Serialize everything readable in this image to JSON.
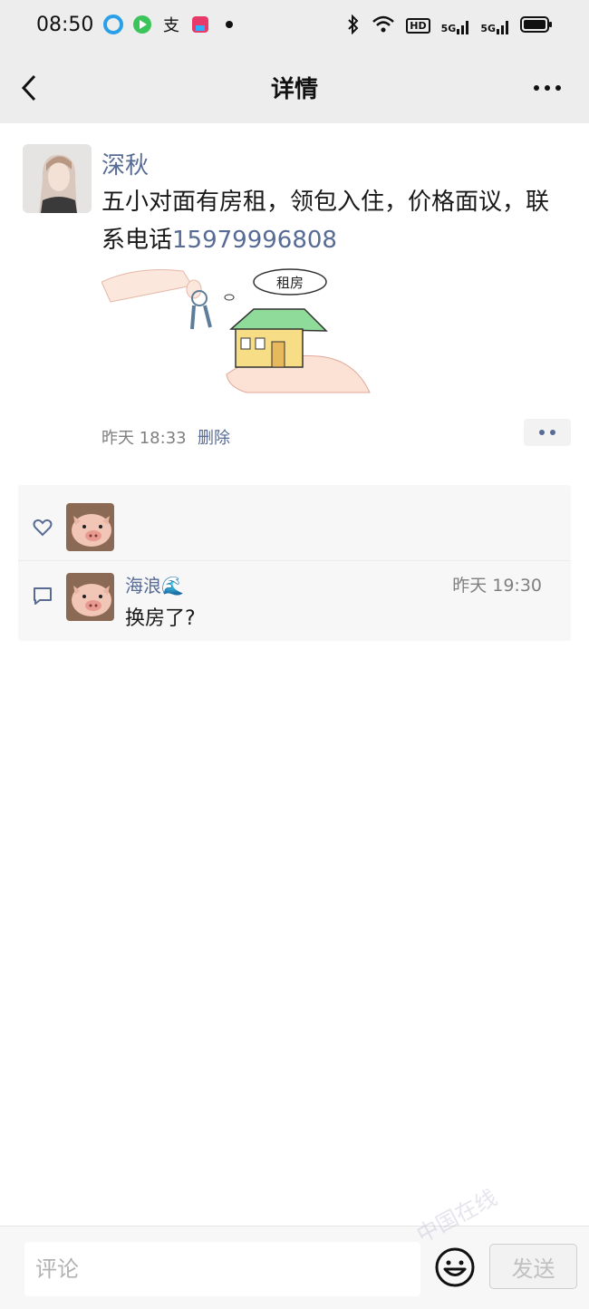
{
  "status_bar": {
    "time": "08:50",
    "hd_badge": "HD",
    "network_1": "5G",
    "network_2": "5G",
    "icons": [
      "browser-icon",
      "video-icon",
      "alipay-icon",
      "app-icon",
      "bluetooth-icon",
      "wifi-icon",
      "signal-icon",
      "battery-icon"
    ]
  },
  "nav": {
    "title": "详情"
  },
  "post": {
    "author": "深秋",
    "text": "五小对面有房租，领包入住，价格面议，联系电话",
    "phone": "15979996808",
    "image_caption": "租房",
    "time": "昨天 18:33",
    "delete_label": "删除"
  },
  "comments": [
    {
      "author": "海浪🌊",
      "time": "昨天 19:30",
      "text": "换房了?"
    }
  ],
  "input_bar": {
    "placeholder": "评论",
    "send_label": "发送"
  },
  "watermark": "中国在线",
  "colors": {
    "link": "#576b95",
    "nav_bg": "#ededed",
    "panel_bg": "#f7f7f7"
  }
}
